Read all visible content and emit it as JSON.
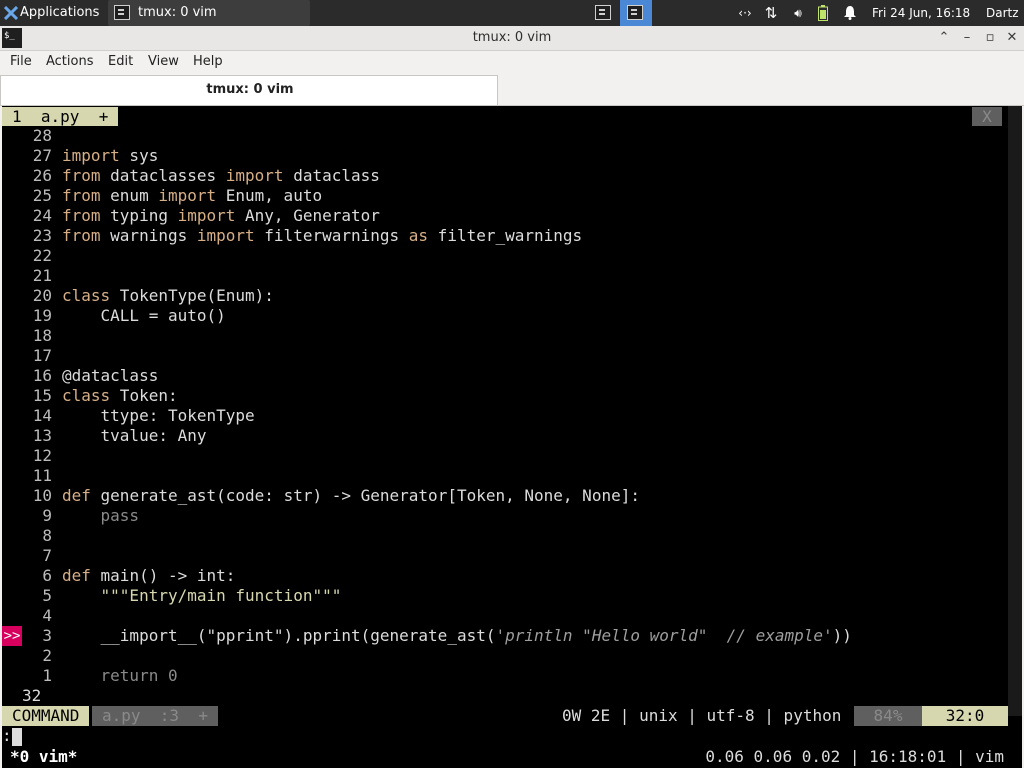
{
  "panel": {
    "apps_label": "Applications",
    "task_title": "tmux: 0 vim",
    "clock": "Fri 24 Jun, 16:18",
    "user": "Dartz"
  },
  "window": {
    "title": "tmux: 0 vim"
  },
  "menubar": {
    "items": [
      "File",
      "Actions",
      "Edit",
      "View",
      "Help"
    ]
  },
  "tab": {
    "label": "tmux: 0 vim"
  },
  "vim": {
    "tab_label": "1  a.py  +",
    "close_label": "X",
    "lines": [
      {
        "n": "28",
        "parts": []
      },
      {
        "n": "27",
        "parts": [
          [
            "kw",
            "import"
          ],
          [
            "t",
            " sys"
          ]
        ]
      },
      {
        "n": "26",
        "parts": [
          [
            "kw",
            "from"
          ],
          [
            "t",
            " dataclasses "
          ],
          [
            "kw",
            "import"
          ],
          [
            "t",
            " dataclass"
          ]
        ]
      },
      {
        "n": "25",
        "parts": [
          [
            "kw",
            "from"
          ],
          [
            "t",
            " enum "
          ],
          [
            "kw",
            "import"
          ],
          [
            "t",
            " Enum, auto"
          ]
        ]
      },
      {
        "n": "24",
        "parts": [
          [
            "kw",
            "from"
          ],
          [
            "t",
            " typing "
          ],
          [
            "kw",
            "import"
          ],
          [
            "t",
            " Any, Generator"
          ]
        ]
      },
      {
        "n": "23",
        "parts": [
          [
            "kw",
            "from"
          ],
          [
            "t",
            " warnings "
          ],
          [
            "kw",
            "import"
          ],
          [
            "t",
            " filterwarnings "
          ],
          [
            "kw",
            "as"
          ],
          [
            "t",
            " filter_warnings"
          ]
        ]
      },
      {
        "n": "22",
        "parts": []
      },
      {
        "n": "21",
        "parts": []
      },
      {
        "n": "20",
        "parts": [
          [
            "kw",
            "class"
          ],
          [
            "t",
            " TokenType(Enum):"
          ]
        ]
      },
      {
        "n": "19",
        "parts": [
          [
            "t",
            "    CALL = auto()"
          ]
        ]
      },
      {
        "n": "18",
        "parts": []
      },
      {
        "n": "17",
        "parts": []
      },
      {
        "n": "16",
        "parts": [
          [
            "t",
            "@dataclass"
          ]
        ]
      },
      {
        "n": "15",
        "parts": [
          [
            "kw",
            "class"
          ],
          [
            "t",
            " Token:"
          ]
        ]
      },
      {
        "n": "14",
        "parts": [
          [
            "t",
            "    ttype: TokenType"
          ]
        ]
      },
      {
        "n": "13",
        "parts": [
          [
            "t",
            "    tvalue: Any"
          ]
        ]
      },
      {
        "n": "12",
        "parts": []
      },
      {
        "n": "11",
        "parts": []
      },
      {
        "n": "10",
        "parts": [
          [
            "kw",
            "def"
          ],
          [
            "t",
            " generate_ast(code: str) -> Generator[Token, None, None]:"
          ]
        ]
      },
      {
        "n": "9",
        "parts": [
          [
            "dim",
            "    pass"
          ]
        ]
      },
      {
        "n": "8",
        "parts": []
      },
      {
        "n": "7",
        "parts": []
      },
      {
        "n": "6",
        "parts": [
          [
            "kw",
            "def"
          ],
          [
            "t",
            " main() -> int:"
          ]
        ]
      },
      {
        "n": "5",
        "parts": [
          [
            "str",
            "    \"\"\"Entry/main function\"\"\""
          ]
        ]
      },
      {
        "n": "4",
        "parts": []
      },
      {
        "n": "3",
        "parts": [
          [
            "t",
            "    __import__(\"pprint\").pprint(generate_ast("
          ],
          [
            "ital",
            "'println \"Hello world\"  // example'"
          ],
          [
            "t",
            "))"
          ]
        ],
        "sign": ">>"
      },
      {
        "n": "2",
        "parts": []
      },
      {
        "n": "1",
        "parts": [
          [
            "dim",
            "    return 0"
          ]
        ]
      },
      {
        "n": "32",
        "parts": [],
        "current": true
      }
    ]
  },
  "statusline": {
    "mode": "COMMAND",
    "file": "a.py  :3  +",
    "info": "0W 2E | unix | utf-8 | python",
    "percent": "84%",
    "position": "32:0"
  },
  "cmdline": ":",
  "tmux": {
    "window": "*0 vim*",
    "right": "0.06 0.06 0.02 | 16:18:01 | vim"
  },
  "colors": {
    "panel_bg": "#2b2b2b",
    "workspace_active": "#4a88d6",
    "vim_statusline": "#d7d7af",
    "sign_bg": "#d7005f"
  }
}
